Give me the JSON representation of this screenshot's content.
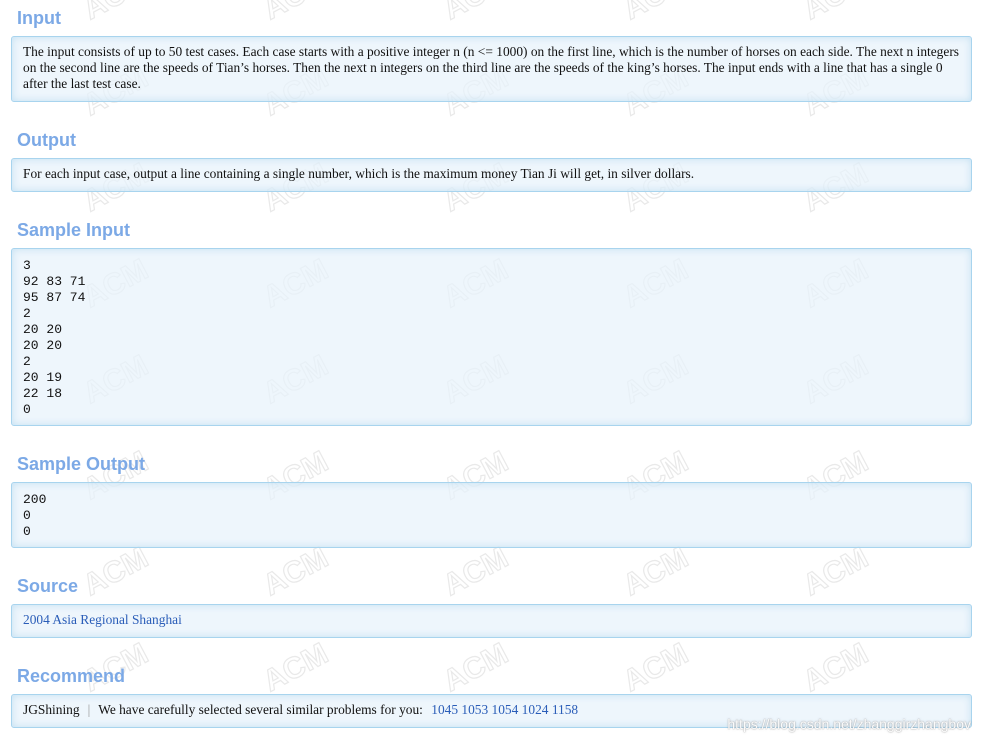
{
  "sections": {
    "input": {
      "title": "Input",
      "text": "The input consists of up to 50 test cases. Each case starts with a positive integer n (n <= 1000) on the first line, which is the number of horses on each side. The next n integers on the second line are the speeds of Tian’s horses. Then the next n integers on the third line are the speeds of the king’s horses. The input ends with a line that has a single 0 after the last test case."
    },
    "output": {
      "title": "Output",
      "text": "For each input case, output a line containing a single number, which is the maximum money Tian Ji will get, in silver dollars."
    },
    "sample_input": {
      "title": "Sample Input",
      "text": "3\n92 83 71\n95 87 74\n2\n20 20\n20 20\n2\n20 19\n22 18\n0"
    },
    "sample_output": {
      "title": "Sample Output",
      "text": "200\n0\n0"
    },
    "source": {
      "title": "Source",
      "link_text": "2004 Asia Regional Shanghai"
    },
    "recommend": {
      "title": "Recommend",
      "author": "JGShining",
      "separator": "|",
      "message": "We have carefully selected several similar problems for you:",
      "problems": [
        "1045",
        "1053",
        "1054",
        "1024",
        "1158"
      ]
    }
  },
  "watermark": {
    "text": "ACM",
    "site_text": "https://blog.csdn.net/zhanggirzhangbov"
  },
  "colors": {
    "title": "#7ca9e6",
    "link": "#2a5db8",
    "panel_border": "#a8d4ee",
    "panel_bg": "#e8f2fb"
  }
}
